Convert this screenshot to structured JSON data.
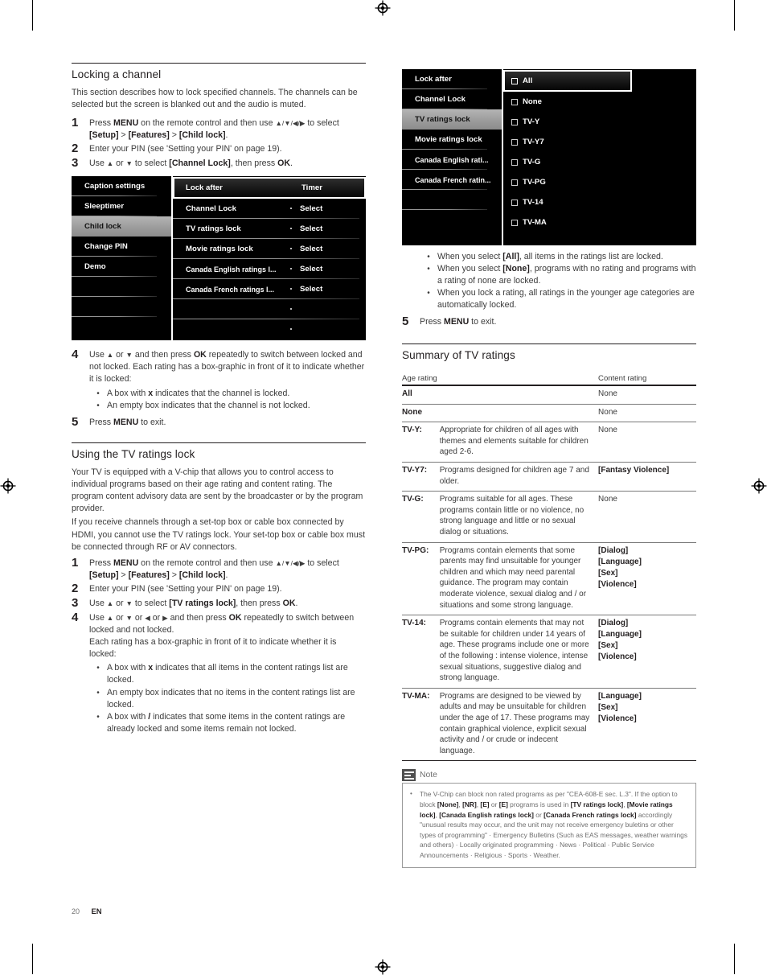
{
  "page": {
    "number": "20",
    "language": "EN"
  },
  "left_column": {
    "section1": {
      "heading": "Locking a channel",
      "intro": "This section describes how to lock specified channels. The channels can be selected but the screen is blanked out and the audio is muted.",
      "steps": [
        {
          "num": "1",
          "text": "Press MENU on the remote control and then use ▲/▼/◄/► to select [Setup] > [Features] > [Child lock]."
        },
        {
          "num": "2",
          "text": "Enter your PIN (see 'Setting your PIN' on page 19)."
        },
        {
          "num": "3",
          "text": "Use ▲ or ▼ to select [Channel Lock], then press OK."
        }
      ],
      "steps_after": [
        {
          "num": "4",
          "text": "Use ▲ or ▼ and then press OK repeatedly to switch between locked and not locked. Each rating has a box-graphic in front of it to indicate whether it is locked:"
        }
      ],
      "bullets_after": [
        "A box with x indicates that the channel is locked.",
        "An empty box indicates that the channel is not locked."
      ],
      "final_step": {
        "num": "5",
        "text": "Press MENU to exit."
      }
    },
    "osd_child_lock": {
      "left_pane": [
        {
          "label": "Caption settings",
          "selected": false
        },
        {
          "label": "Sleeptimer",
          "selected": false
        },
        {
          "label": "Child lock",
          "selected": true
        },
        {
          "label": "Change PIN",
          "selected": false
        },
        {
          "label": "Demo",
          "selected": false
        },
        {
          "label": "",
          "selected": false
        },
        {
          "label": "",
          "selected": false
        }
      ],
      "mid_pane": [
        {
          "label": "Lock after",
          "value": "Timer",
          "focused": true
        },
        {
          "label": "Channel Lock",
          "value": "Select",
          "focused": false
        },
        {
          "label": "TV ratings lock",
          "value": "Select",
          "focused": false
        },
        {
          "label": "Movie ratings lock",
          "value": "Select",
          "focused": false
        },
        {
          "label": "Canada English ratings l...",
          "value": "Select",
          "focused": false
        },
        {
          "label": "Canada French ratings l...",
          "value": "Select",
          "focused": false
        },
        {
          "label": "",
          "value": "",
          "focused": false
        },
        {
          "label": "",
          "value": "",
          "focused": false
        }
      ]
    },
    "section2": {
      "heading": "Using the TV ratings lock",
      "para1": "Your TV is equipped with a V-chip that allows you to control access to individual programs based on their age rating and content rating. The program content advisory data are sent by the broadcaster or by the program provider.",
      "para2": "If you receive channels through a set-top box or cable box connected by HDMI, you cannot use the TV ratings lock. Your set-top box or cable box must be connected through RF or AV connectors.",
      "steps": [
        {
          "num": "1",
          "text": "Press MENU on the remote control and then use ▲/▼/◄/► to select [Setup] > [Features] > [Child lock]."
        },
        {
          "num": "2",
          "text": "Enter your PIN (see 'Setting your PIN' on page 19)."
        },
        {
          "num": "3",
          "text": "Use ▲ or ▼ to select [TV ratings lock], then press OK."
        },
        {
          "num": "4",
          "text": "Use ▲ or ▼ or ◄ or ► and then press OK repeatedly to switch between locked and not locked."
        }
      ],
      "sub_para": "Each rating has a box-graphic in front of it to indicate whether it is locked:",
      "bullets": [
        "A box with x indicates that all items in the content ratings list are locked.",
        "An empty box indicates that no items in the content ratings list are locked.",
        "A box with / indicates that some items in the content ratings are already locked and some items remain not locked."
      ]
    }
  },
  "right_column": {
    "osd_tv_ratings": {
      "left_pane": [
        {
          "label": "Lock after",
          "selected": false
        },
        {
          "label": "Channel Lock",
          "selected": false
        },
        {
          "label": "TV ratings lock",
          "selected": true
        },
        {
          "label": "Movie ratings lock",
          "selected": false
        },
        {
          "label": "Canada English rati...",
          "selected": false
        },
        {
          "label": "Canada French ratin...",
          "selected": false
        },
        {
          "label": "",
          "selected": false
        },
        {
          "label": "",
          "selected": false
        }
      ],
      "right_pane": [
        {
          "label": "All",
          "checked": false,
          "focused": true
        },
        {
          "label": "None",
          "checked": false,
          "focused": false
        },
        {
          "label": "TV-Y",
          "checked": false,
          "focused": false
        },
        {
          "label": "TV-Y7",
          "checked": false,
          "focused": false
        },
        {
          "label": "TV-G",
          "checked": false,
          "focused": false
        },
        {
          "label": "TV-PG",
          "checked": false,
          "focused": false
        },
        {
          "label": "TV-14",
          "checked": false,
          "focused": false
        },
        {
          "label": "TV-MA",
          "checked": false,
          "focused": false
        }
      ]
    },
    "bullets": [
      "When you select [All], all items in the ratings list are locked.",
      "When you select [None], programs with no rating and programs with a rating of none are locked.",
      "When you lock a rating, all ratings in the younger age categories are automatically locked."
    ],
    "final_step": {
      "num": "5",
      "text": "Press MENU to exit."
    },
    "summary": {
      "heading": "Summary of TV ratings",
      "columns": [
        "Age rating",
        "Content rating"
      ],
      "rows": [
        {
          "label": "All",
          "desc": "",
          "content": [
            "None"
          ]
        },
        {
          "label": "None",
          "desc": "",
          "content": [
            "None"
          ]
        },
        {
          "label": "TV-Y:",
          "desc": "Appropriate for children of all ages with themes and elements suitable for children aged 2-6.",
          "content": [
            "None"
          ]
        },
        {
          "label": "TV-Y7:",
          "desc": "Programs designed for children age 7 and older.",
          "content": [
            "[Fantasy Violence]"
          ]
        },
        {
          "label": "TV-G:",
          "desc": "Programs suitable for all ages. These programs contain little or no violence, no strong language and little or no sexual dialog or situations.",
          "content": [
            "None"
          ]
        },
        {
          "label": "TV-PG:",
          "desc": "Programs contain elements that some parents may find unsuitable for younger children and which may need parental guidance. The program may contain moderate violence, sexual dialog and / or situations and some strong language.",
          "content": [
            "[Dialog]",
            "[Language]",
            "[Sex]",
            "[Violence]"
          ]
        },
        {
          "label": "TV-14:",
          "desc": "Programs contain elements that may not be suitable for children under 14 years of age. These programs include one or more of the following : intense violence, intense sexual situations, suggestive dialog and strong language.",
          "content": [
            "[Dialog]",
            "[Language]",
            "[Sex]",
            "[Violence]"
          ]
        },
        {
          "label": "TV-MA:",
          "desc": "Programs are designed to be viewed by adults and may be unsuitable for children under the age of 17. These programs may contain graphical violence, explicit sexual activity and / or crude or indecent language.",
          "content": [
            "[Language]",
            "[Sex]",
            "[Violence]"
          ]
        }
      ]
    },
    "note": {
      "title": "Note",
      "text": "The V-Chip can block non rated programs as per \"CEA-608-E sec. L.3\". If the option to block [None], [NR], [E] or [E] programs is used in [TV ratings lock], [Movie ratings lock], [Canada English ratings lock] or [Canada French ratings lock] accordingly \"unusual results may occur, and the unit may not receive emergency buletins or other types of programming\" · Emergency Bulletins (Such as EAS messages, weather warnings and others) · Locally originated programming · News · Political · Public Service Announcements · Religious · Sports · Weather."
    }
  }
}
